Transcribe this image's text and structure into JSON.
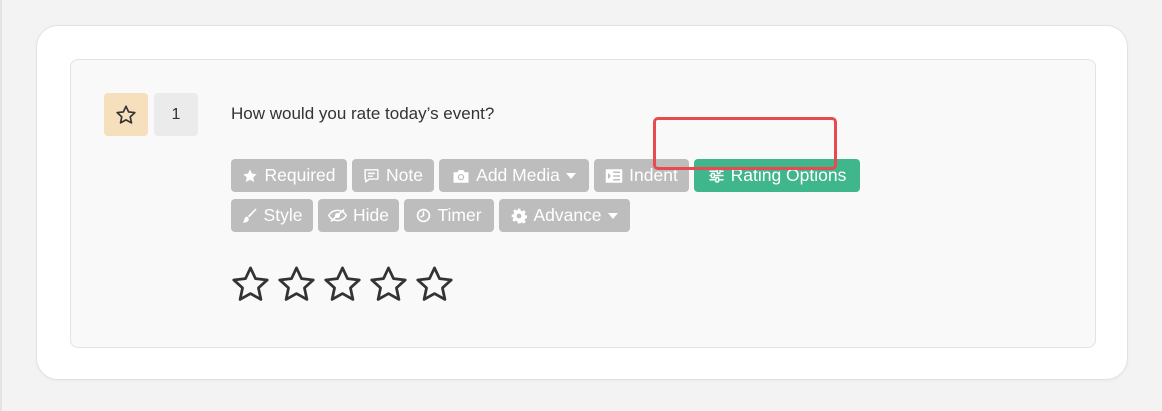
{
  "question": {
    "number": "1",
    "text": "How would you rate today’s event?",
    "type_icon": "star-outline-icon",
    "rating": 0,
    "rating_max": 5
  },
  "toolbar": {
    "required_label": "Required",
    "note_label": "Note",
    "add_media_label": "Add Media",
    "indent_label": "Indent",
    "rating_options_label": "Rating Options",
    "style_label": "Style",
    "hide_label": "Hide",
    "timer_label": "Timer",
    "advance_label": "Advance"
  },
  "colors": {
    "button_default": "#bdbdbd",
    "button_active": "#3fb68b",
    "type_badge": "#f6dfbd",
    "highlight": "#e84a4f"
  }
}
